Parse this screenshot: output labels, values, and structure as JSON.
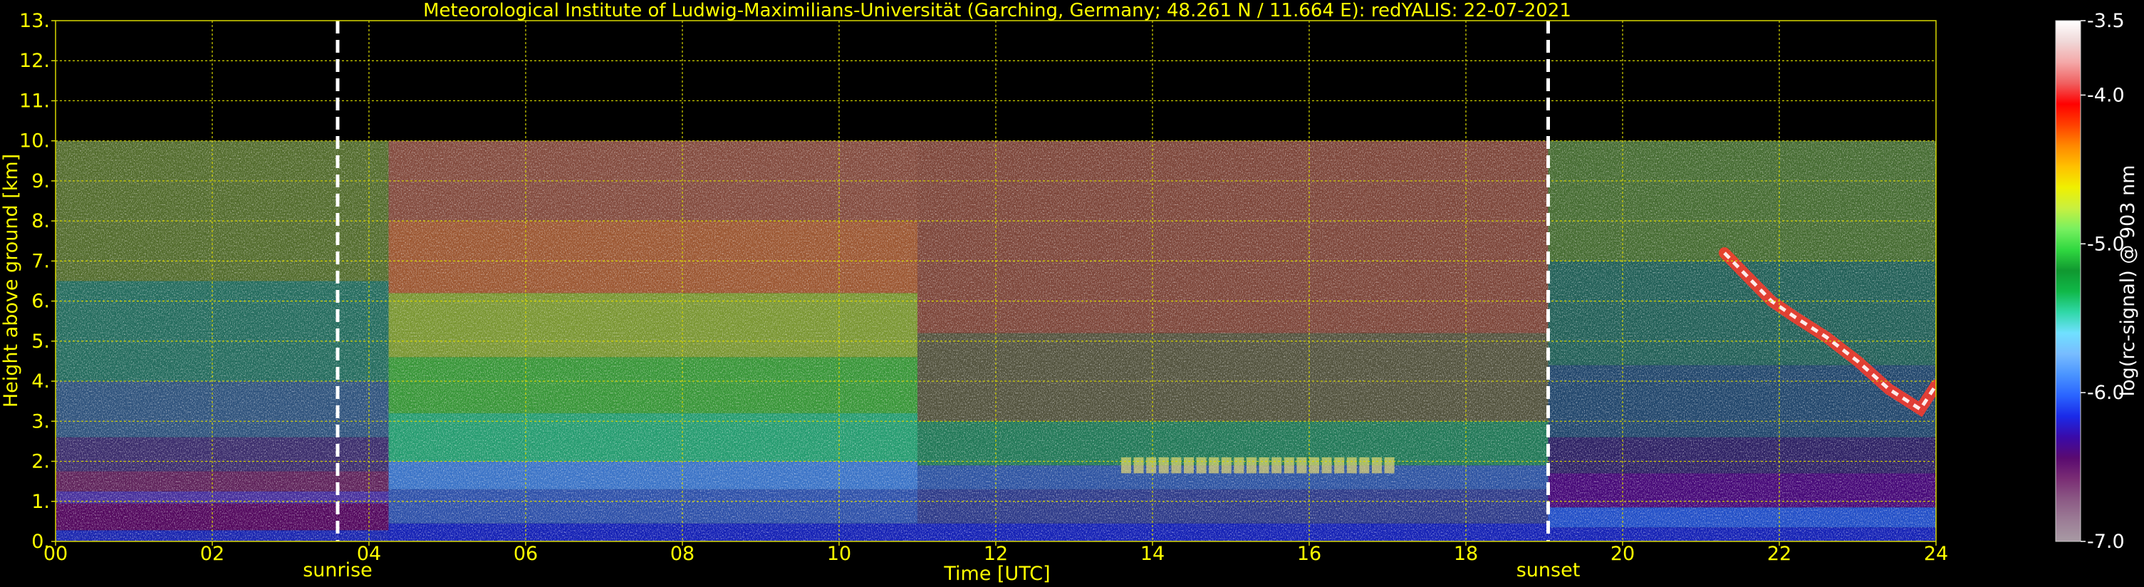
{
  "chart_data": {
    "type": "heatmap",
    "title": "Meteorological Institute of Ludwig-Maximilians-Universität (Garching, Germany; 48.261 N / 11.664 E):    redYALIS: 22-07-2021",
    "xlabel": "Time [UTC]",
    "ylabel": "Height above ground [km]",
    "xlim": [
      0,
      24
    ],
    "ylim": [
      0,
      13
    ],
    "x_ticks": [
      "00",
      "02",
      "04",
      "06",
      "08",
      "10",
      "12",
      "14",
      "16",
      "18",
      "20",
      "22",
      "24"
    ],
    "y_ticks": [
      "0.",
      "1.",
      "2.",
      "3.",
      "4.",
      "5.",
      "6.",
      "7.",
      "8.",
      "9.",
      "10.",
      "11.",
      "12.",
      "13."
    ],
    "grid": true,
    "colorbar": {
      "label": "log(rc-signal) @ 903 nm",
      "range": [
        -7.0,
        -3.5
      ],
      "ticks": [
        "-3.5",
        "-4.0",
        "-5.0",
        "-6.0",
        "-7.0"
      ],
      "tick_values": [
        -3.5,
        -4.0,
        -5.0,
        -6.0,
        -7.0
      ],
      "colors": [
        "#a89aa4",
        "#9c7d96",
        "#8c5a85",
        "#7a2d74",
        "#5a0a70",
        "#3a0aa8",
        "#1a2ae8",
        "#2a64ff",
        "#4a94ff",
        "#78bcff",
        "#70e0ff",
        "#30d8a8",
        "#10b848",
        "#109830",
        "#30d840",
        "#78f060",
        "#c8f040",
        "#f0f000",
        "#ffc000",
        "#ff8800",
        "#ff4000",
        "#ff0000",
        "#f06060",
        "#f4a8a8",
        "#f0d8d8",
        "#ffffff"
      ]
    },
    "annotations": [
      {
        "text": "sunrise",
        "x": 3.6
      },
      {
        "text": "sunset",
        "x": 19.05
      }
    ],
    "data_ceiling_km": 10.0,
    "colors": {
      "text": "#ffff00",
      "grid": "#d8d800",
      "background": "#000000",
      "marker_lines": "#ffffff"
    }
  }
}
